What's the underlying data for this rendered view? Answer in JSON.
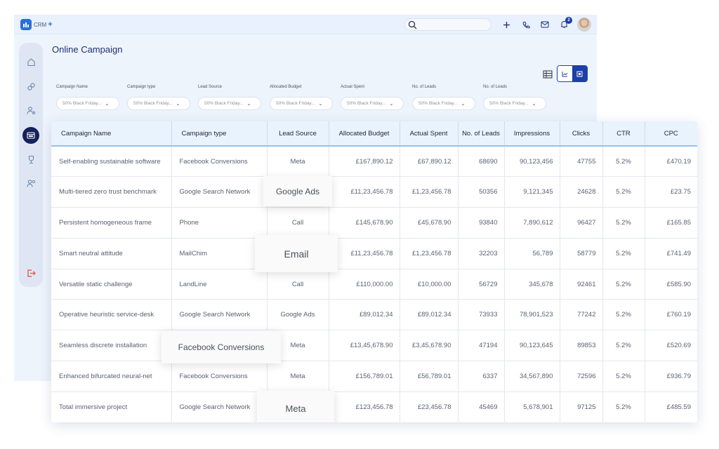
{
  "app": {
    "logo_text": "CRM",
    "logo_plus": "+",
    "notification_count": "2"
  },
  "page": {
    "title": "Online Campaign"
  },
  "filters": [
    {
      "label": "Campaign Name",
      "value": "50% Black Friday..."
    },
    {
      "label": "Campaign type",
      "value": "50% Black Friday..."
    },
    {
      "label": "Lead Source",
      "value": "50% Black Friday..."
    },
    {
      "label": "Allocated Budget",
      "value": "50% Black Friday..."
    },
    {
      "label": "Actual Spent",
      "value": "50% Black Friday..."
    },
    {
      "label": "No. of Leads",
      "value": "50% Black Friday..."
    },
    {
      "label": "No. of Leads",
      "value": "50% Black Friday..."
    }
  ],
  "table": {
    "columns": [
      "Campaign Name",
      "Campaign type",
      "Lead Source",
      "Allocated Budget",
      "Actual Spent",
      "No. of Leads",
      "Impressions",
      "Clicks",
      "CTR",
      "CPC"
    ],
    "rows": [
      [
        "Self-enabling sustainable software",
        "Facebook Conversions",
        "Meta",
        "£167,890.12",
        "£67,890.12",
        "68690",
        "90,123,456",
        "47755",
        "5.2%",
        "£470.19"
      ],
      [
        "Multi-tiered zero trust benchmark",
        "Google Search Network",
        "",
        "£11,23,456.78",
        "£1,23,456.78",
        "50356",
        "9,121,345",
        "24628",
        "5.2%",
        "£23.75"
      ],
      [
        "Persistent homogeneous frame",
        "Phone",
        "Call",
        "£145,678.90",
        "£45,678.90",
        "93840",
        "7,890,612",
        "96427",
        "5.2%",
        "£165.85"
      ],
      [
        "Smart neutral attitude",
        "MailChim",
        "",
        "£11,23,456.78",
        "£1,23,456.78",
        "32203",
        "56,789",
        "58779",
        "5.2%",
        "£741.49"
      ],
      [
        "Versatile static challenge",
        "LandLine",
        "Call",
        "£110,000.00",
        "£10,000.00",
        "56729",
        "345,678",
        "92461",
        "5.2%",
        "£585.90"
      ],
      [
        "Operative heuristic service-desk",
        "Google Search Network",
        "Google Ads",
        "£89,012.34",
        "£89,012.34",
        "73933",
        "78,901,523",
        "77242",
        "5.2%",
        "£760.19"
      ],
      [
        "Seamless discrete installation",
        "",
        "Meta",
        "£13,45,678.90",
        "£3,45,678.90",
        "47194",
        "90,123,645",
        "89853",
        "5.2%",
        "£520.69"
      ],
      [
        "Enhanced bifurcated neural-net",
        "Facebook Conversions",
        "Meta",
        "£156,789.01",
        "£56,789.01",
        "6337",
        "34,567,890",
        "72596",
        "5.2%",
        "£936.79"
      ],
      [
        "Total immersive project",
        "Google Search Network",
        "",
        "£123,456.78",
        "£23,456.78",
        "45469",
        "5,678,901",
        "97125",
        "5.2%",
        "£485.59"
      ]
    ]
  },
  "chips": {
    "google_ads": "Google Ads",
    "email": "Email",
    "facebook": "Facebook Conversions",
    "meta": "Meta"
  }
}
